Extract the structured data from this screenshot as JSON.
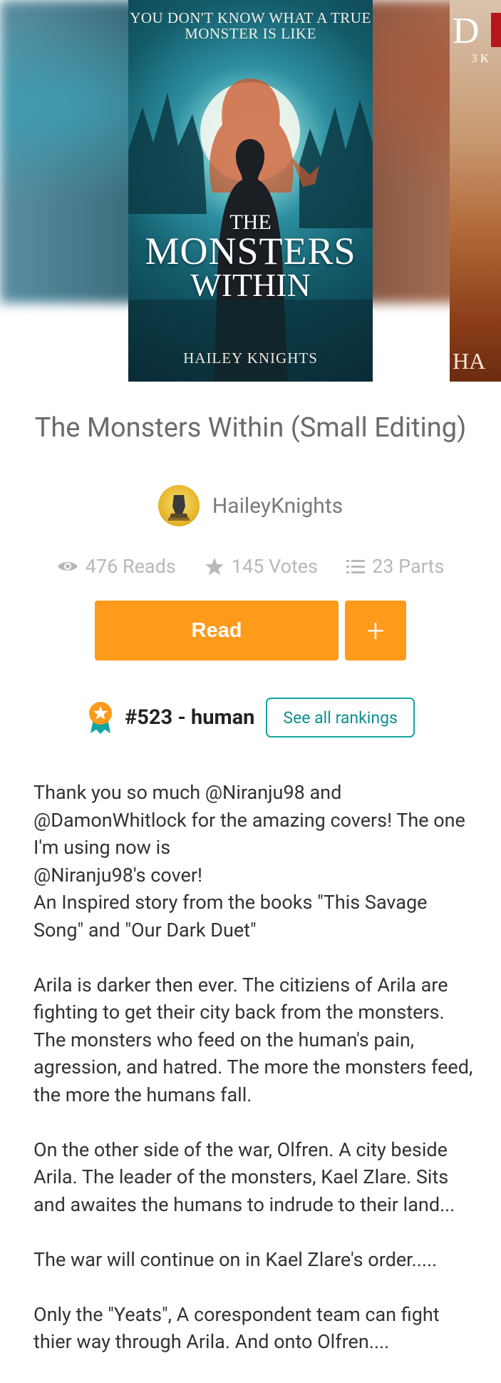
{
  "cover": {
    "tagline": "YOU DON'T KNOW WHAT A TRUE MONSTER IS LIKE",
    "title_small": "THE",
    "title_big": "MONSTERS",
    "title_big2": "WITHIN",
    "author": "HAILEY KNIGHTS"
  },
  "next_cover": {
    "title_fragment": "D",
    "sub_fragment": "3 K",
    "author_fragment": "HA"
  },
  "story": {
    "title": "The Monsters Within (Small Editing)",
    "author": "HaileyKnights"
  },
  "stats": {
    "reads": "476 Reads",
    "votes": "145 Votes",
    "parts": "23 Parts"
  },
  "actions": {
    "read_label": "Read",
    "add_label": "+"
  },
  "ranking": {
    "text": "#523 - human",
    "link_label": "See all rankings"
  },
  "description": [
    "Thank you so much @Niranju98 and @DamonWhitlock for the amazing covers! The one I'm using now is\n@Niranju98's cover!\nAn Inspired story from the books \"This Savage Song\" and \"Our Dark Duet\"",
    "Arila is darker then ever. The citiziens of Arila are fighting to get their city back from the monsters. The monsters who feed on the human's pain, agression, and hatred. The more the monsters feed, the more the humans fall.",
    "On the other side of the war, Olfren. A city beside Arila. The leader of the monsters, Kael Zlare. Sits and awaites the humans to indrude to their land...",
    "The war will continue on in Kael Zlare's order.....",
    "Only the \"Yeats\",  A corespondent team can fight thier way through Arila. And onto Olfren...."
  ],
  "colors": {
    "accent_orange": "#ff9a1a",
    "teal": "#12a4a4",
    "muted_text": "#b8b8b8"
  }
}
